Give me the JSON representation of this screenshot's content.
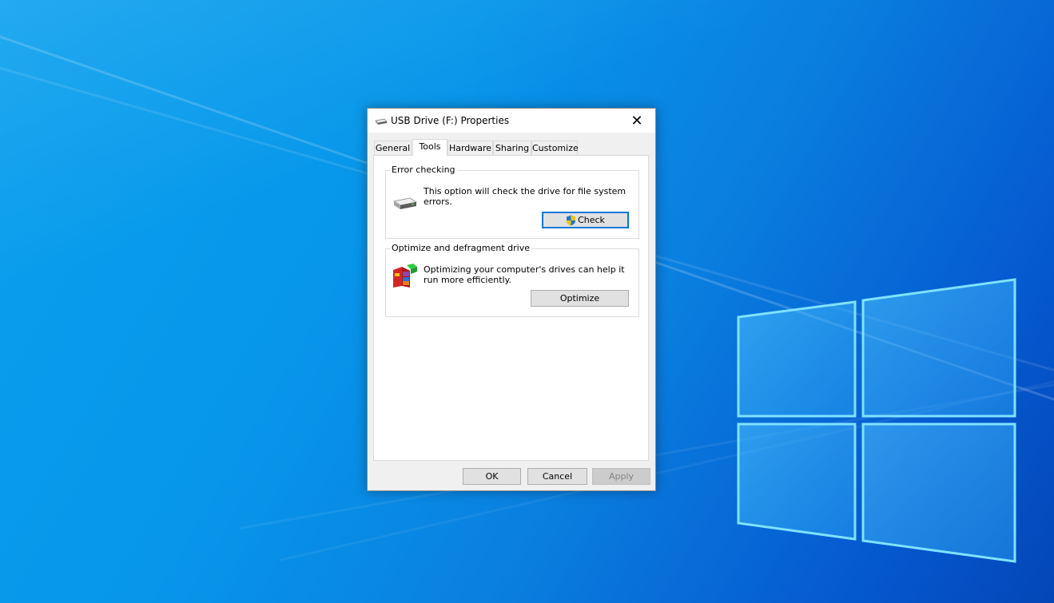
{
  "dialog": {
    "title": "USB Drive (F:) Properties",
    "close_glyph": "✕",
    "icons": {
      "title": "usb-drive-icon",
      "close": "close-icon"
    }
  },
  "tabs": [
    {
      "label": "General",
      "active": false
    },
    {
      "label": "Tools",
      "active": true
    },
    {
      "label": "Hardware",
      "active": false
    },
    {
      "label": "Sharing",
      "active": false
    },
    {
      "label": "Customize",
      "active": false
    }
  ],
  "error_checking": {
    "legend": "Error checking",
    "description": "This option will check the drive for file system errors.",
    "button_label": "Check",
    "icons": {
      "main": "drive-icon",
      "button": "uac-shield-icon"
    }
  },
  "optimize": {
    "legend": "Optimize and defragment drive",
    "description": "Optimizing your computer's drives can help it run more efficiently.",
    "button_label": "Optimize",
    "icons": {
      "main": "defragment-icon"
    }
  },
  "footer": {
    "ok_label": "OK",
    "cancel_label": "Cancel",
    "apply_label": "Apply",
    "apply_enabled": false
  },
  "colors": {
    "desktop_accent": "#0a7fe0",
    "focus_border": "#0078d7"
  }
}
